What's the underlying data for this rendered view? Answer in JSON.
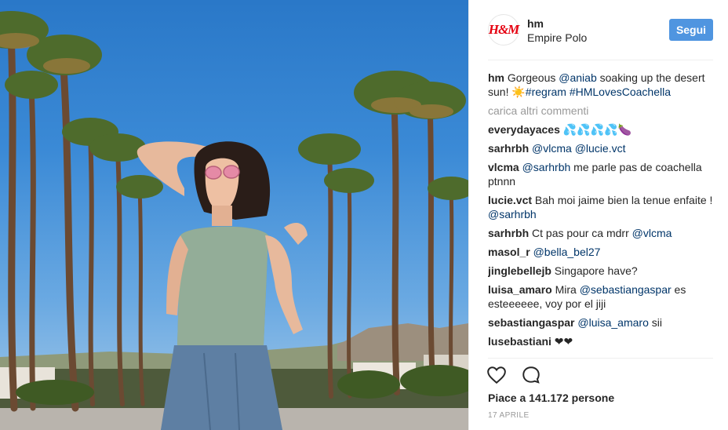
{
  "post": {
    "username": "hm",
    "avatar_text": "H&M",
    "location": "Empire Polo",
    "follow_label": "Segui",
    "brand_color": "#e50010",
    "accent_color": "#4f95e0"
  },
  "caption": {
    "user": "hm",
    "text_before": " Gorgeous ",
    "mention": "@aniab",
    "text_after": " soaking up the desert sun! ",
    "emoji": "☀️",
    "hashtags": "#regram #HMLovesCoachella"
  },
  "load_more_label": "carica altri commenti",
  "comments": [
    {
      "user": "everydayaces",
      "parts": [
        {
          "t": " 💦💦💦💦🍆",
          "link": false
        }
      ]
    },
    {
      "user": "sarhrbh",
      "parts": [
        {
          "t": " ",
          "link": false
        },
        {
          "t": "@vlcma",
          "link": true
        },
        {
          "t": " ",
          "link": false
        },
        {
          "t": "@lucie.vct",
          "link": true
        }
      ]
    },
    {
      "user": "vlcma",
      "parts": [
        {
          "t": " ",
          "link": false
        },
        {
          "t": "@sarhrbh",
          "link": true
        },
        {
          "t": " me parle pas de coachella ptnnn",
          "link": false
        }
      ]
    },
    {
      "user": "lucie.vct",
      "parts": [
        {
          "t": " Bah moi jaime bien la tenue enfaite ! ",
          "link": false
        },
        {
          "t": "@sarhrbh",
          "link": true
        }
      ]
    },
    {
      "user": "sarhrbh",
      "parts": [
        {
          "t": " Ct pas pour ca mdrr ",
          "link": false
        },
        {
          "t": "@vlcma",
          "link": true
        }
      ]
    },
    {
      "user": "masol_r",
      "parts": [
        {
          "t": " ",
          "link": false
        },
        {
          "t": "@bella_bel27",
          "link": true
        }
      ]
    },
    {
      "user": "jinglebellejb",
      "parts": [
        {
          "t": " Singapore have?",
          "link": false
        }
      ]
    },
    {
      "user": "luisa_amaro",
      "parts": [
        {
          "t": " Mira ",
          "link": false
        },
        {
          "t": "@sebastiangaspar",
          "link": true
        },
        {
          "t": " es esteeeeee, voy por el jiji",
          "link": false
        }
      ]
    },
    {
      "user": "sebastiangaspar",
      "parts": [
        {
          "t": " ",
          "link": false
        },
        {
          "t": "@luisa_amaro",
          "link": true
        },
        {
          "t": " sii",
          "link": false
        }
      ]
    },
    {
      "user": "lusebastiani",
      "parts": [
        {
          "t": " ❤❤",
          "link": false
        }
      ]
    },
    {
      "user": "",
      "parts": [
        {
          "t": "...",
          "link": false
        }
      ]
    }
  ],
  "actions": {
    "like_icon": "heart-icon",
    "comment_icon": "comment-icon"
  },
  "likes_label": "Piace a 141.172 persone",
  "date_label": "17 APRILE"
}
